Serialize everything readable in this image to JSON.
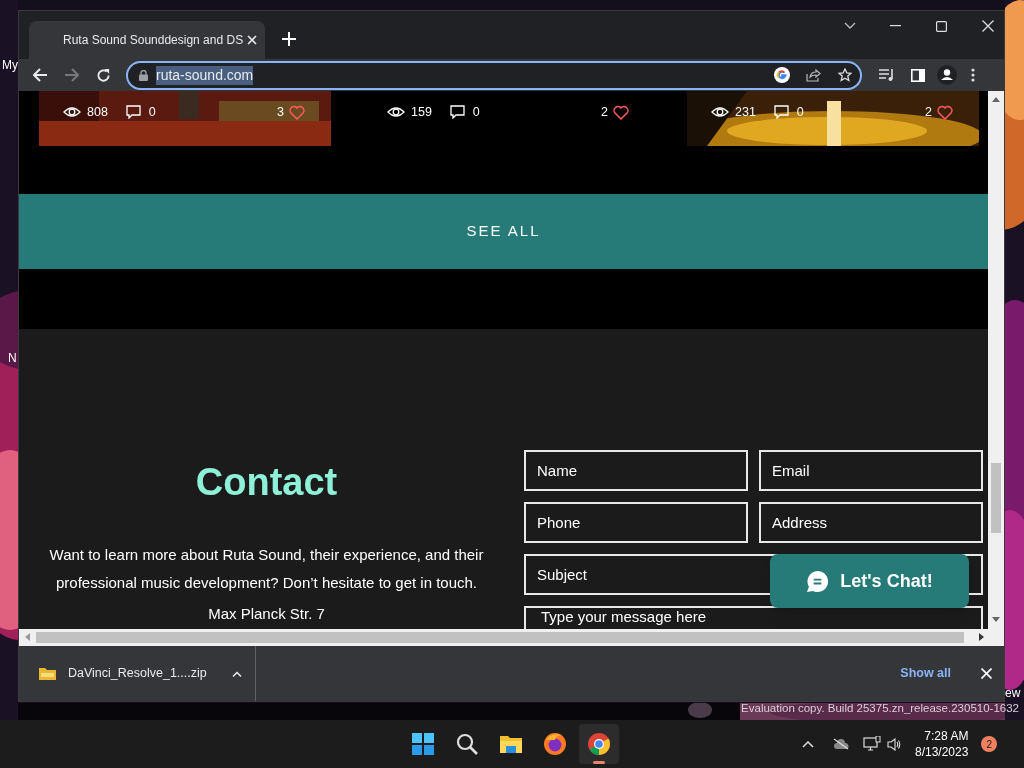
{
  "desktop": {
    "labels": [
      {
        "text": "My",
        "kind": "top"
      },
      {
        "text": "N",
        "kind": "middle"
      },
      {
        "text": "ew",
        "kind": "right"
      }
    ],
    "build_text": "Evaluation copy. Build 25375.zn_release.230510-1632"
  },
  "browser": {
    "tab_title": "Ruta Sound Sounddesign and DS",
    "address": "ruta-sound.com",
    "address_selected": true
  },
  "page": {
    "cards": [
      {
        "kind": "picture",
        "views": "808",
        "comments": "0",
        "likes": "3"
      },
      {
        "kind": "blank",
        "views": "159",
        "comments": "0",
        "likes": "2"
      },
      {
        "kind": "picture",
        "views": "231",
        "comments": "0",
        "likes": "2"
      }
    ],
    "see_all": "SEE ALL",
    "contact": {
      "heading": "Contact",
      "text": "Want to learn more about Ruta Sound, their experience, and their professional music development? Don’t hesitate to get in touch.",
      "address_line": "Max Planck Str. 7"
    },
    "form": {
      "fields": [
        {
          "placeholder": "Name",
          "kind": "half"
        },
        {
          "placeholder": "Email",
          "kind": "half"
        },
        {
          "placeholder": "Phone",
          "kind": "half"
        },
        {
          "placeholder": "Address",
          "kind": "half"
        },
        {
          "placeholder": "Subject",
          "kind": "full"
        }
      ],
      "message_placeholder": "Type your message here"
    },
    "chat_button": "Let's Chat!"
  },
  "downloads": {
    "file": "DaVinci_Resolve_1....zip",
    "show_all": "Show all"
  },
  "taskbar": {
    "apps": [
      {
        "kind": "start",
        "active": false
      },
      {
        "kind": "search",
        "active": false
      },
      {
        "kind": "files",
        "active": false
      },
      {
        "kind": "firefox",
        "active": false
      },
      {
        "kind": "chrome",
        "active": true
      }
    ],
    "time": "7:28 AM",
    "date": "8/13/2023",
    "badge": "2"
  }
}
